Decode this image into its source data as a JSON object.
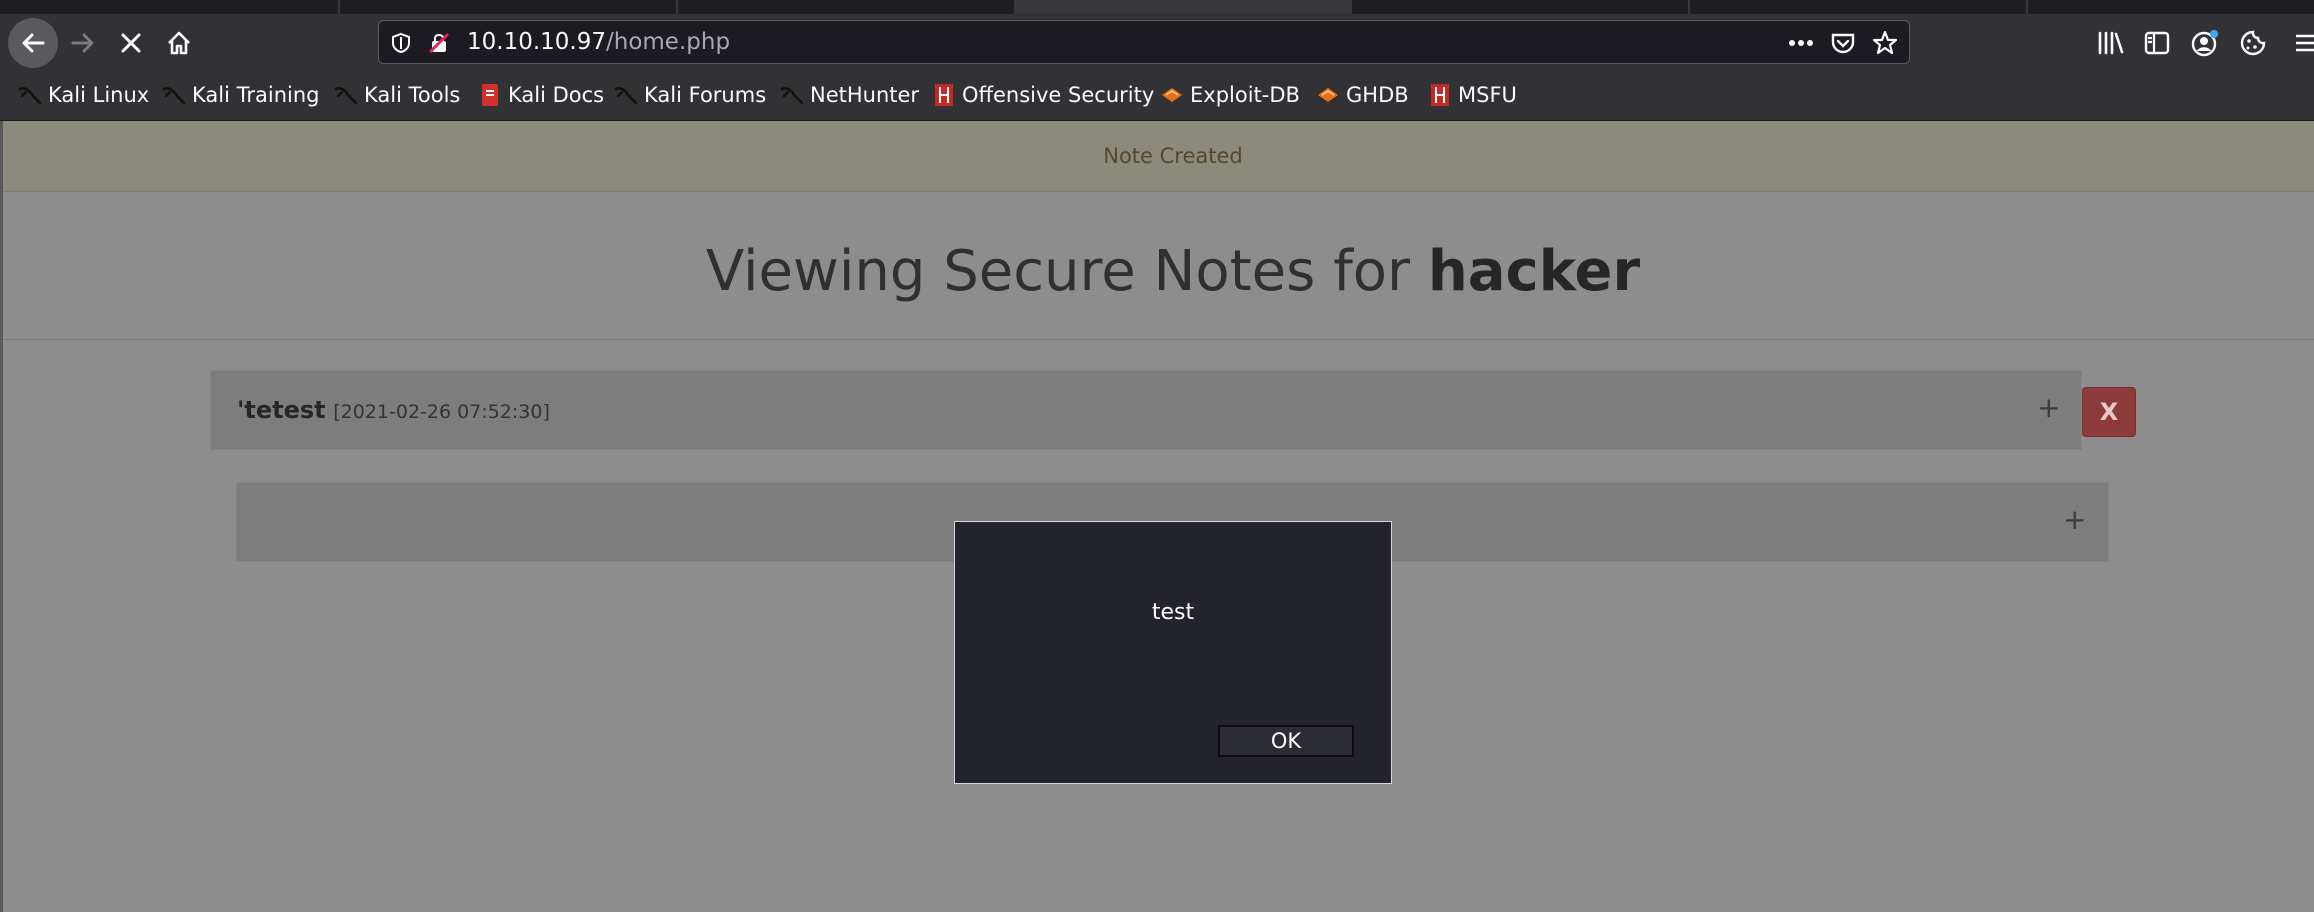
{
  "browser": {
    "url_host": "10.10.10.97",
    "url_path": "/home.php",
    "bookmarks": [
      {
        "label": "Kali Linux",
        "icon": "kali-dragon-icon"
      },
      {
        "label": "Kali Training",
        "icon": "kali-dragon-icon"
      },
      {
        "label": "Kali Tools",
        "icon": "kali-dragon-icon"
      },
      {
        "label": "Kali Docs",
        "icon": "kali-docs-icon"
      },
      {
        "label": "Kali Forums",
        "icon": "kali-dragon-icon"
      },
      {
        "label": "NetHunter",
        "icon": "kali-dragon-icon"
      },
      {
        "label": "Offensive Security",
        "icon": "offsec-icon"
      },
      {
        "label": "Exploit-DB",
        "icon": "exploitdb-icon"
      },
      {
        "label": "GHDB",
        "icon": "exploitdb-icon"
      },
      {
        "label": "MSFU",
        "icon": "offsec-icon"
      }
    ]
  },
  "page": {
    "alert": "Note Created",
    "heading_prefix": "Viewing Secure Notes for ",
    "heading_user": "hacker",
    "notes": [
      {
        "title": "'tetest",
        "date": "[2021-02-26 07:52:30]",
        "expand": "+",
        "delete": "X"
      },
      {
        "title": "",
        "date": "",
        "expand": "+"
      }
    ]
  },
  "dialog": {
    "message": "test",
    "ok_label": "OK"
  },
  "colors": {
    "accent_delete": "#8c3a3a",
    "alert_bg": "#8c8a7b",
    "dialog_bg": "#23232b"
  }
}
